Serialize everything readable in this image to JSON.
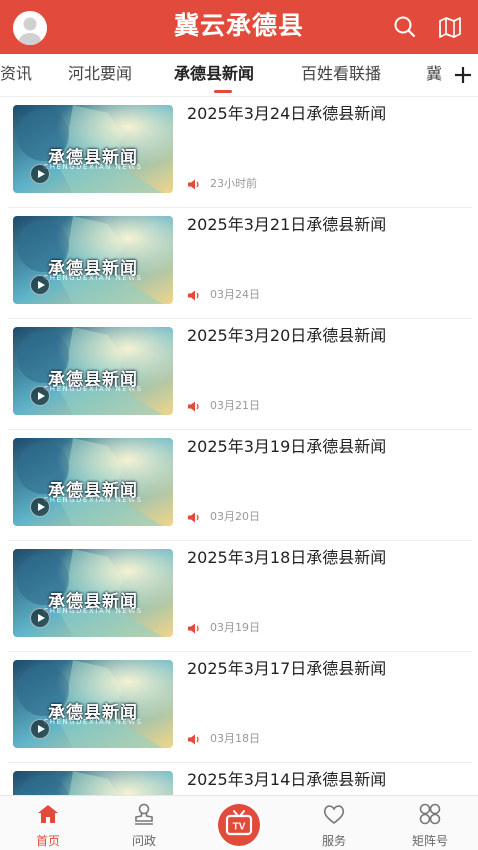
{
  "header": {
    "title": "冀云承德县",
    "accent_color": "#e24b3b",
    "avatar_icon": "user-avatar-icon",
    "search_icon": "search-icon",
    "map_icon": "map-icon"
  },
  "tabs": [
    {
      "label": "资讯"
    },
    {
      "label": "河北要闻"
    },
    {
      "label": "承德县新闻",
      "active": true
    },
    {
      "label": "百姓看联播"
    },
    {
      "label": "冀"
    }
  ],
  "thumbnail": {
    "caption": "承德县新闻",
    "subcaption": "CHENGDEXIAN NEWS"
  },
  "news": [
    {
      "title": "2025年3月24日承德县新闻",
      "time": "23小时前"
    },
    {
      "title": "2025年3月21日承德县新闻",
      "time": "03月24日"
    },
    {
      "title": "2025年3月20日承德县新闻",
      "time": "03月21日"
    },
    {
      "title": "2025年3月19日承德县新闻",
      "time": "03月20日"
    },
    {
      "title": "2025年3月18日承德县新闻",
      "time": "03月19日"
    },
    {
      "title": "2025年3月17日承德县新闻",
      "time": "03月18日"
    },
    {
      "title": "2025年3月14日承德县新闻",
      "time": ""
    }
  ],
  "bottom_nav": [
    {
      "label": "首页",
      "icon": "home-icon",
      "active": true
    },
    {
      "label": "问政",
      "icon": "stamp-icon"
    },
    {
      "label": "",
      "icon": "tv-icon"
    },
    {
      "label": "服务",
      "icon": "heart-icon"
    },
    {
      "label": "矩阵号",
      "icon": "matrix-icon"
    }
  ]
}
